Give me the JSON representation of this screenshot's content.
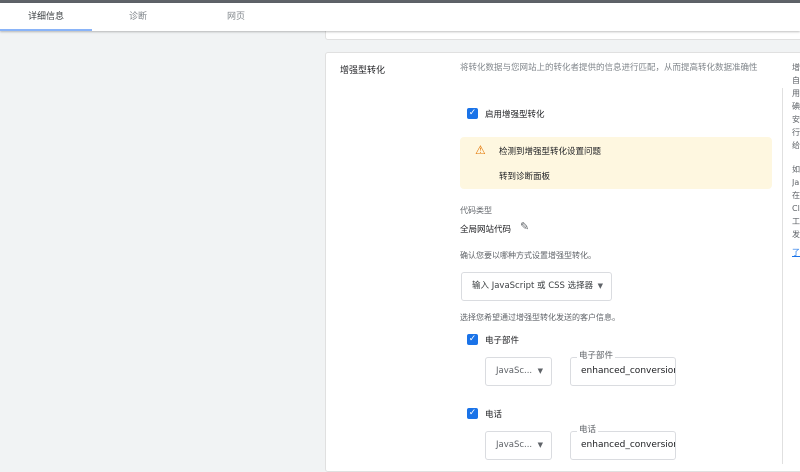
{
  "tabs": [
    {
      "label": "详细信息",
      "active": true
    },
    {
      "label": "诊断",
      "active": false
    },
    {
      "label": "网页",
      "active": false
    }
  ],
  "section": {
    "title": "增强型转化",
    "description": "将转化数据与您网站上的转化者提供的信息进行匹配，从而提高转化数据准确性"
  },
  "enable_checkbox": {
    "label": "启用增强型转化",
    "checked": true
  },
  "warning": {
    "icon": "warning-triangle-icon",
    "message": "检测到增强型转化设置问题",
    "link": "转到诊断面板",
    "color": "#e37400"
  },
  "code_type": {
    "label": "代码类型",
    "value": "全局网站代码",
    "edit_icon": "pencil-icon"
  },
  "method": {
    "prompt": "确认您要以哪种方式设置增强型转化。",
    "selected": "输入 JavaScript 或 CSS 选择器"
  },
  "customer_info": {
    "prompt": "选择您希望通过增强型转化发送的客户信息。",
    "fields": [
      {
        "label": "电子部件",
        "checked": true,
        "type": "JavaSc...",
        "input_label": "电子部件",
        "value": "enhanced_conversior"
      },
      {
        "label": "电话",
        "checked": true,
        "type": "JavaSc...",
        "input_label": "电话",
        "value": "enhanced_conversior"
      }
    ]
  },
  "side_panel": {
    "lines1": [
      "增",
      "自",
      "用",
      "碘",
      "安",
      "行",
      "给"
    ],
    "lines2": [
      "如",
      "Ja",
      "在",
      "Cl",
      "工",
      "发"
    ],
    "link": "了"
  },
  "accent": "#1a73e8"
}
